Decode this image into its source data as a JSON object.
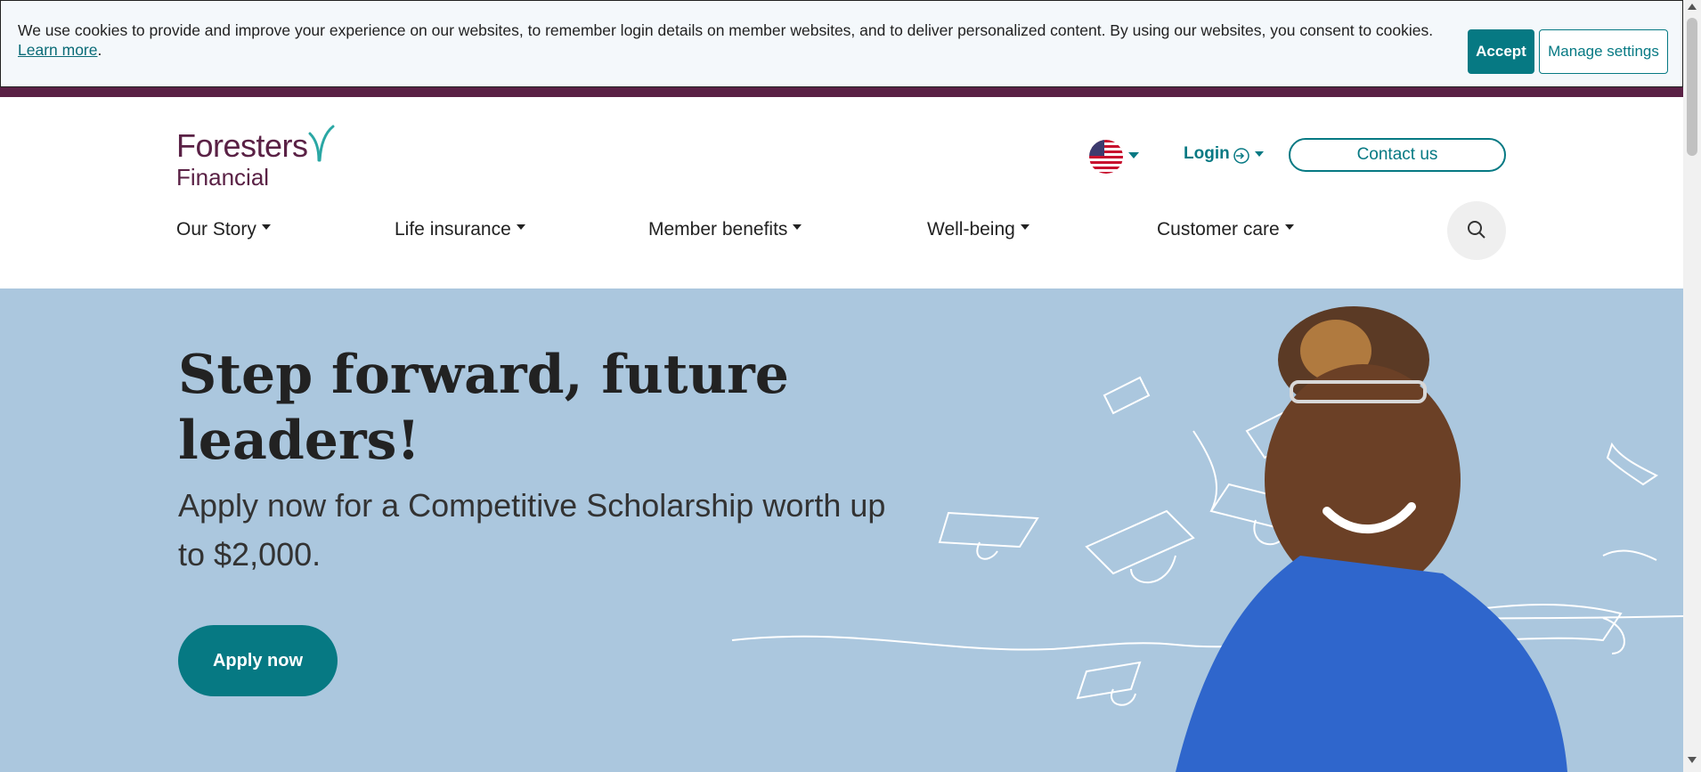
{
  "cookie_banner": {
    "text": "We use cookies to provide and improve your experience on our websites, to remember login details on member websites, and to deliver personalized content. By using our websites, you consent to cookies.",
    "link": "Learn more",
    "trailing": ".",
    "accept": "Accept",
    "manage": "Manage settings"
  },
  "header": {
    "logo_line1": "Foresters",
    "logo_line2": "Financial",
    "flag_icon": "us-flag-icon",
    "login": "Login",
    "contact": "Contact us"
  },
  "nav": {
    "items": [
      "Our Story",
      "Life insurance",
      "Member benefits",
      "Well-being",
      "Customer care"
    ]
  },
  "hero": {
    "title": "Step forward, future leaders!",
    "subtitle": "Apply now for a Competitive Scholarship worth up to $2,000.",
    "cta": "Apply now"
  },
  "colors": {
    "brand_purple": "#5a2145",
    "teal": "#067983",
    "hero_bg": "#abc7de"
  }
}
